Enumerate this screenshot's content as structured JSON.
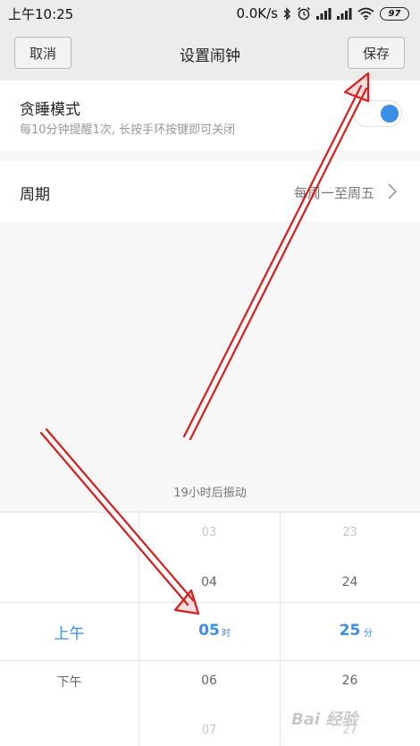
{
  "status_bar": {
    "time": "上午10:25",
    "net_speed": "0.0K/s",
    "battery": "97",
    "icons": [
      "bluetooth-icon",
      "alarm-icon",
      "signal-icon",
      "signal-icon",
      "wifi-icon",
      "battery-icon"
    ]
  },
  "header": {
    "cancel_label": "取消",
    "title": "设置闹钟",
    "save_label": "保存"
  },
  "snooze": {
    "title": "贪睡模式",
    "subtitle": "每10分钟提醒1次, 长按手环按键即可关闭",
    "enabled": true
  },
  "period": {
    "label": "周期",
    "value": "每周一至周五",
    "chevron": "chevron-right-icon"
  },
  "hint": "19小时后振动",
  "picker": {
    "ampm": {
      "above": "",
      "selected": "上午",
      "below": "下午"
    },
    "hours": [
      "03",
      "04",
      "05",
      "06",
      "07"
    ],
    "hour_selected": "05",
    "hour_unit": "时",
    "minutes": [
      "23",
      "24",
      "25",
      "26",
      "27"
    ],
    "minute_selected": "25",
    "minute_unit": "分"
  },
  "watermark": "Bai 经验",
  "colors": {
    "accent": "#3a8ee6",
    "annotation": "#d81e1e"
  }
}
